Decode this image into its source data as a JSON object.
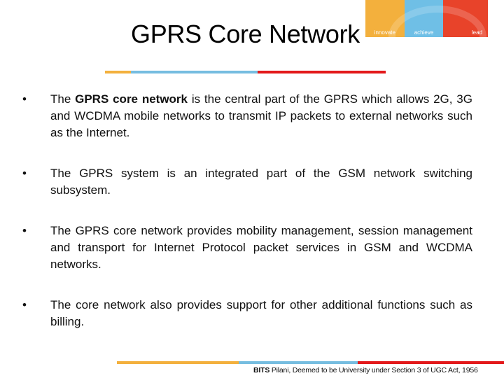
{
  "logo": {
    "segments": [
      {
        "label": "innovate",
        "color": "#f3b03d"
      },
      {
        "label": "achieve",
        "color": "#6fbfe6"
      },
      {
        "label": "lead",
        "color": "#e8432a"
      }
    ]
  },
  "title": "GPRS Core Network",
  "bullets": [
    {
      "bullet": "•",
      "prefix": "The ",
      "bold": "GPRS core network",
      "text": " is the central part of the  GPRS which allows 2G, 3G and WCDMA mobile networks to transmit IP packets to external networks such as the Internet."
    },
    {
      "bullet": "•",
      "prefix": "",
      "bold": "",
      "text": "The GPRS system is an integrated part of the GSM network switching subsystem."
    },
    {
      "bullet": "•",
      "prefix": "",
      "bold": "",
      "text": "The GPRS core network provides mobility management, session management and transport for Internet Protocol packet services in GSM and WCDMA networks."
    },
    {
      "bullet": "•",
      "prefix": "",
      "bold": "",
      "text": "The core network also provides support for other additional functions such as billing."
    }
  ],
  "footer": {
    "bold": "BITS",
    "text": " Pilani, Deemed to be University under Section 3 of UGC Act, 1956"
  },
  "colors": {
    "orange": "#f3b03d",
    "blue": "#76bde0",
    "red": "#e3191b"
  }
}
